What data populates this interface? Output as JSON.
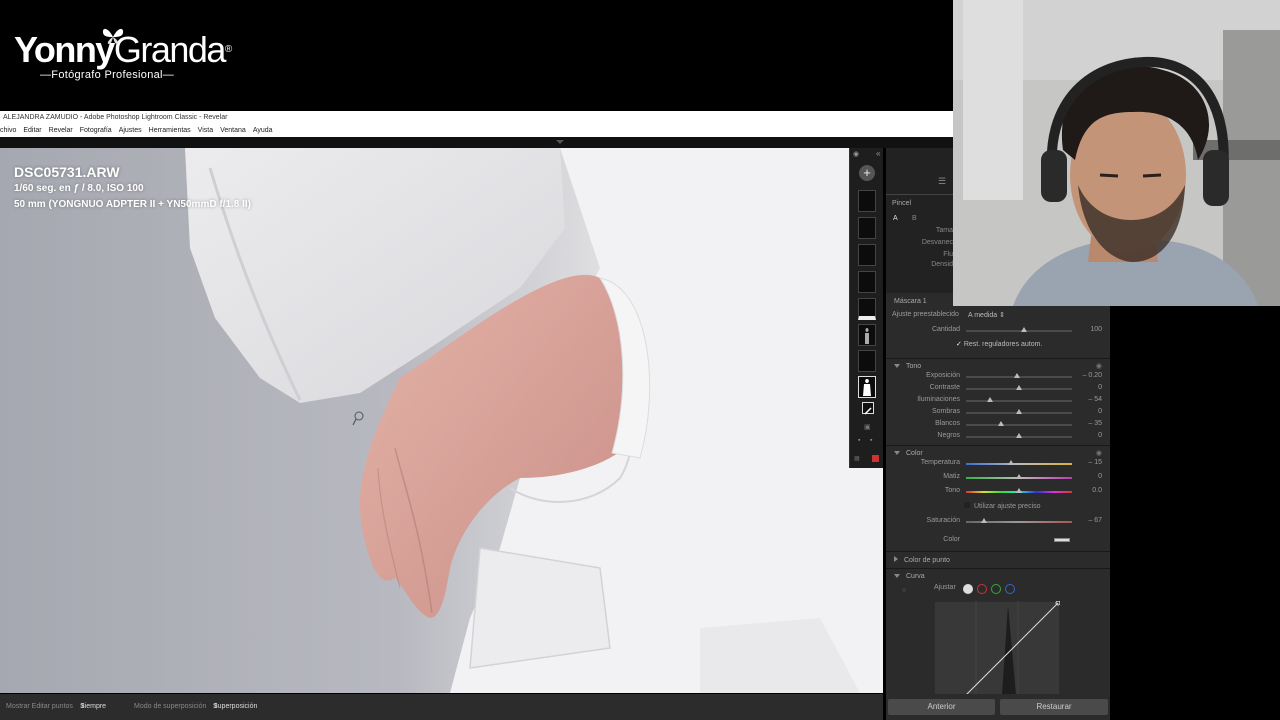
{
  "branding": {
    "name_bold": "Yonny",
    "name_light": "Granda",
    "registered": "®",
    "tagline": "—Fotógrafo Profesional—"
  },
  "window": {
    "title": "ALEJANDRA ZAMUDIO - Adobe Photoshop Lightroom Classic - Revelar"
  },
  "menu": [
    "chivo",
    "Editar",
    "Revelar",
    "Fotografía",
    "Ajustes",
    "Herramientas",
    "Vista",
    "Ventana",
    "Ayuda"
  ],
  "photo_info": {
    "filename": "DSC05731.ARW",
    "exposure": "1/60 seg. en ƒ / 8.0, ISO 100",
    "lens": "50 mm (YONGNUO ADPTER II + YN50mmD f/1.8 II)"
  },
  "brush_panel": {
    "title": "Pincel",
    "tab_a": "A",
    "tab_b": "B",
    "labels": [
      "Tama",
      "Desvanec",
      "Flu",
      "Densid"
    ]
  },
  "mask_panel": {
    "mask_name": "Máscara 1",
    "preset_label": "Ajuste preestablecido",
    "preset_value": "A medida",
    "amount_label": "Cantidad",
    "amount_value": "100",
    "amount_pct": 0.55,
    "reset_label": "Rest. reguladores autom."
  },
  "tone": {
    "header": "Tono",
    "sliders": [
      {
        "label": "Exposición",
        "value": "– 0.20",
        "pct": 0.48
      },
      {
        "label": "Contraste",
        "value": "0",
        "pct": 0.5
      },
      {
        "label": "Iluminaciones",
        "value": "– 54",
        "pct": 0.23
      },
      {
        "label": "Sombras",
        "value": "0",
        "pct": 0.5
      },
      {
        "label": "Blancos",
        "value": "– 35",
        "pct": 0.33
      },
      {
        "label": "Negros",
        "value": "0",
        "pct": 0.5
      }
    ]
  },
  "color": {
    "header": "Color",
    "sliders": [
      {
        "label": "Temperatura",
        "value": "– 15",
        "pct": 0.42
      },
      {
        "label": "Matiz",
        "value": "0",
        "pct": 0.5
      },
      {
        "label": "Tono",
        "value": "0.0",
        "pct": 0.5
      }
    ],
    "precise_label": "Utilizar ajuste preciso",
    "saturation_label": "Saturación",
    "saturation_value": "– 67",
    "saturation_pct": 0.17,
    "color_label": "Color"
  },
  "point_color": {
    "header": "Color de punto"
  },
  "curve": {
    "header": "Curva",
    "adjust_label": "Ajustar"
  },
  "buttons": {
    "previous": "Anterior",
    "reset": "Restaurar"
  },
  "bottombar": {
    "show_edit_points": "Mostrar Editar puntos",
    "show_value": "Siempre",
    "overlay_mode_label": "Modo de superposición",
    "overlay_mode_value": "Superposición de colores"
  },
  "colors": {
    "accent_knob": "#bbbbbb",
    "panel_bg": "#2b2b2b",
    "skin": "#d7a29a"
  }
}
